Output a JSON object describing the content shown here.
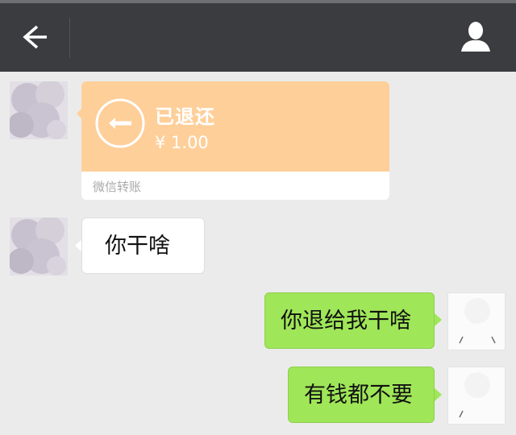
{
  "navbar": {
    "back_icon": "arrow-left-icon",
    "contact_icon": "person-icon",
    "background": "#3a3c3f"
  },
  "messages": [
    {
      "side": "left",
      "type": "transfer",
      "status": "已退还",
      "amount": "¥ 1.00",
      "footer": "微信转账",
      "icon": "return-arrow-icon",
      "color": "#fecf99"
    },
    {
      "side": "left",
      "type": "text",
      "text": "你干啥"
    },
    {
      "side": "right",
      "type": "text",
      "text": "你退给我干啥",
      "color": "#9fe658"
    },
    {
      "side": "right",
      "type": "text",
      "text": "有钱都不要",
      "color": "#9fe658"
    }
  ]
}
